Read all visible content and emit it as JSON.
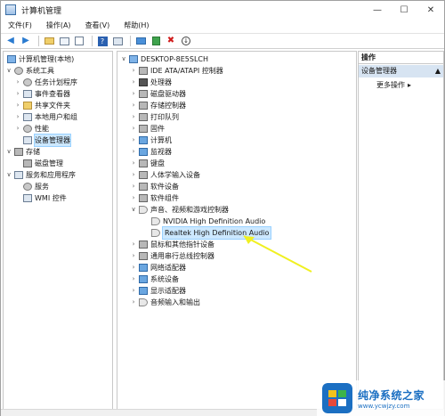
{
  "window": {
    "title": "计算机管理",
    "controls": [
      "—",
      "☐",
      "✕"
    ]
  },
  "menu": [
    "文件(F)",
    "操作(A)",
    "查看(V)",
    "帮助(H)"
  ],
  "toolbar": {
    "icons": [
      "back-icon",
      "forward-icon",
      "up-folder-icon",
      "show-hide-tree-icon",
      "help-icon",
      "properties-icon",
      "monitor-icon",
      "update-driver-icon",
      "uninstall-icon",
      "scan-hardware-icon"
    ]
  },
  "left_tree": {
    "root": "计算机管理(本地)",
    "items": [
      {
        "label": "系统工具",
        "level": 1,
        "expanded": true
      },
      {
        "label": "任务计划程序",
        "level": 2
      },
      {
        "label": "事件查看器",
        "level": 2
      },
      {
        "label": "共享文件夹",
        "level": 2
      },
      {
        "label": "本地用户和组",
        "level": 2
      },
      {
        "label": "性能",
        "level": 2
      },
      {
        "label": "设备管理器",
        "level": 2,
        "selected": true
      },
      {
        "label": "存储",
        "level": 1,
        "expanded": true
      },
      {
        "label": "磁盘管理",
        "level": 2
      },
      {
        "label": "服务和应用程序",
        "level": 1,
        "expanded": true
      },
      {
        "label": "服务",
        "level": 2
      },
      {
        "label": "WMI 控件",
        "level": 2
      }
    ]
  },
  "device_tree": {
    "root": "DESKTOP-8E5SLCH",
    "items": [
      {
        "label": "IDE ATA/ATAPI 控制器",
        "icon": "disk"
      },
      {
        "label": "处理器",
        "icon": "dark"
      },
      {
        "label": "磁盘驱动器",
        "icon": "disk"
      },
      {
        "label": "存储控制器",
        "icon": "disk"
      },
      {
        "label": "打印队列",
        "icon": "disk"
      },
      {
        "label": "固件",
        "icon": "disk"
      },
      {
        "label": "计算机",
        "icon": "monitor"
      },
      {
        "label": "监视器",
        "icon": "monitor"
      },
      {
        "label": "键盘",
        "icon": "disk"
      },
      {
        "label": "人体学输入设备",
        "icon": "disk"
      },
      {
        "label": "软件设备",
        "icon": "disk"
      },
      {
        "label": "软件组件",
        "icon": "disk"
      },
      {
        "label": "声音、视频和游戏控制器",
        "icon": "speaker",
        "expanded": true
      },
      {
        "label": "NVIDIA High Definition Audio",
        "icon": "speaker",
        "child": true
      },
      {
        "label": "Realtek High Definition Audio",
        "icon": "speaker",
        "child": true,
        "selected": true
      },
      {
        "label": "鼠标和其他指针设备",
        "icon": "disk"
      },
      {
        "label": "通用串行总线控制器",
        "icon": "disk"
      },
      {
        "label": "网络适配器",
        "icon": "monitor"
      },
      {
        "label": "系统设备",
        "icon": "monitor"
      },
      {
        "label": "显示适配器",
        "icon": "monitor"
      },
      {
        "label": "音频输入和输出",
        "icon": "speaker"
      }
    ]
  },
  "actions": {
    "header": "操作",
    "section": "设备管理器",
    "more": "更多操作"
  },
  "watermark": {
    "title": "纯净系统之家",
    "url": "www.ycwjzy.com"
  },
  "colors": {
    "accent": "#1b6fc2",
    "selection": "#cce8ff",
    "annotation": "#f0f020"
  }
}
